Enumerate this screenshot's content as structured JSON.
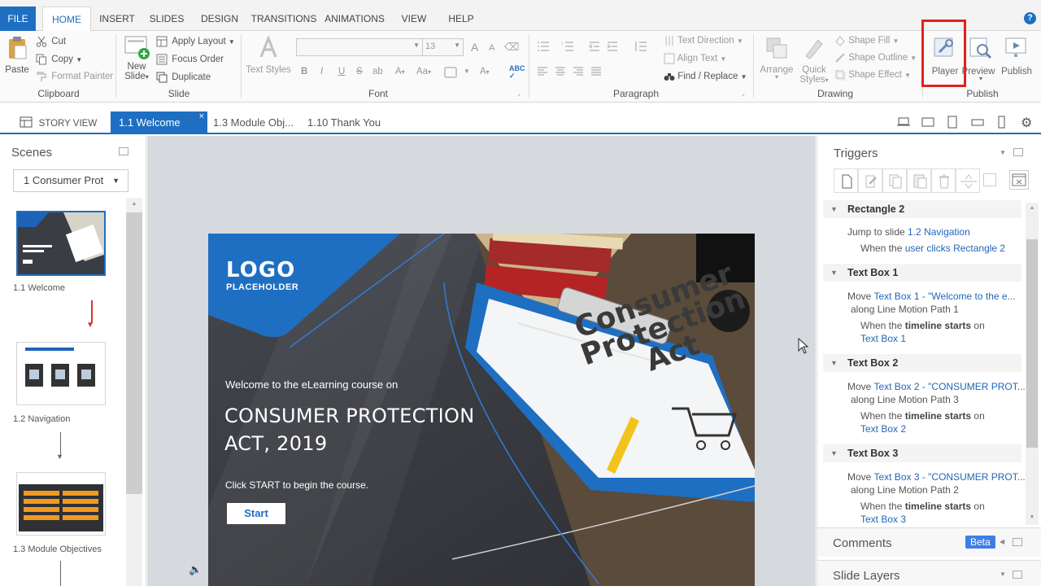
{
  "ribbon_tabs": [
    "FILE",
    "HOME",
    "INSERT",
    "SLIDES",
    "DESIGN",
    "TRANSITIONS",
    "ANIMATIONS",
    "VIEW",
    "HELP"
  ],
  "clipboard": {
    "paste": "Paste",
    "cut": "Cut",
    "copy": "Copy",
    "format_painter": "Format Painter",
    "label": "Clipboard"
  },
  "slide_group": {
    "new_slide_1": "New",
    "new_slide_2": "Slide",
    "apply_layout": "Apply Layout",
    "focus_order": "Focus Order",
    "duplicate": "Duplicate",
    "label": "Slide"
  },
  "font_group": {
    "text_styles_1": "Text Styles",
    "font_size": "13",
    "label": "Font",
    "b": "B",
    "i": "I",
    "u": "U",
    "s": "S",
    "ab": "ab",
    "aa": "Aa",
    "grow": "A",
    "shrink": "A",
    "color": "A"
  },
  "paragraph": {
    "text_direction": "Text Direction",
    "align_text": "Align Text",
    "find_replace": "Find / Replace",
    "label": "Paragraph"
  },
  "drawing": {
    "arrange": "Arrange",
    "quick_1": "Quick",
    "quick_2": "Styles",
    "shape_fill": "Shape Fill",
    "shape_outline": "Shape Outline",
    "shape_effect": "Shape Effect",
    "label": "Drawing"
  },
  "publish": {
    "player": "Player",
    "preview": "Preview",
    "publish": "Publish",
    "label": "Publish"
  },
  "view_tabs": {
    "story_view": "STORY VIEW",
    "welcome": "1.1 Welcome",
    "module": "1.3 Module Obj...",
    "thankyou": "1.10 Thank You"
  },
  "scenes": {
    "title": "Scenes",
    "dropdown": "1 Consumer Prot",
    "items": [
      {
        "label": "1.1 Welcome"
      },
      {
        "label": "1.2 Navigation"
      },
      {
        "label": "1.3 Module Objectives"
      }
    ]
  },
  "slide": {
    "logo": "LOGO",
    "logo_sub": "PLACEHOLDER",
    "welcome": "Welcome to the eLearning course on",
    "title_1": "CONSUMER PROTECTION",
    "title_2": "ACT, 2019",
    "click": "Click START to begin the course.",
    "start": "Start",
    "clipboard_1": "Consumer",
    "clipboard_2": "Protection",
    "clipboard_3": "Act"
  },
  "triggers": {
    "title": "Triggers",
    "items": [
      {
        "head": "Rectangle 2",
        "l1a": "Jump to slide ",
        "l1b": "1.2 Navigation",
        "l2a": "When the ",
        "l2b": "user clicks",
        "l2c": " ",
        "l2d": "Rectangle 2"
      },
      {
        "head": "Text Box 1",
        "l1a": "Move ",
        "l1b": "Text Box 1",
        "l1c": " - \"Welcome to the e...",
        "l1d": "along Line Motion Path 1",
        "l2a": "When the ",
        "l2b": "timeline starts",
        "l2c": " on",
        "l3": "Text Box 1"
      },
      {
        "head": "Text Box 2",
        "l1a": "Move ",
        "l1b": "Text Box 2",
        "l1c": " - \"CONSUMER PROT...",
        "l1d": "along Line Motion Path 3",
        "l2a": "When the ",
        "l2b": "timeline starts",
        "l2c": " on",
        "l3": "Text Box 2"
      },
      {
        "head": "Text Box 3",
        "l1a": "Move ",
        "l1b": "Text Box 3",
        "l1c": " - \"CONSUMER PROT...",
        "l1d": "along Line Motion Path 2",
        "l2a": "When the ",
        "l2b": "timeline starts",
        "l2c": " on",
        "l3": "Text Box 3"
      }
    ],
    "comments": "Comments",
    "beta": "Beta",
    "slide_layers": "Slide Layers"
  },
  "colors": {
    "accent": "#1e6fc1",
    "highlight_box": "#e2211c",
    "slide_bg": "#3a3d42"
  }
}
